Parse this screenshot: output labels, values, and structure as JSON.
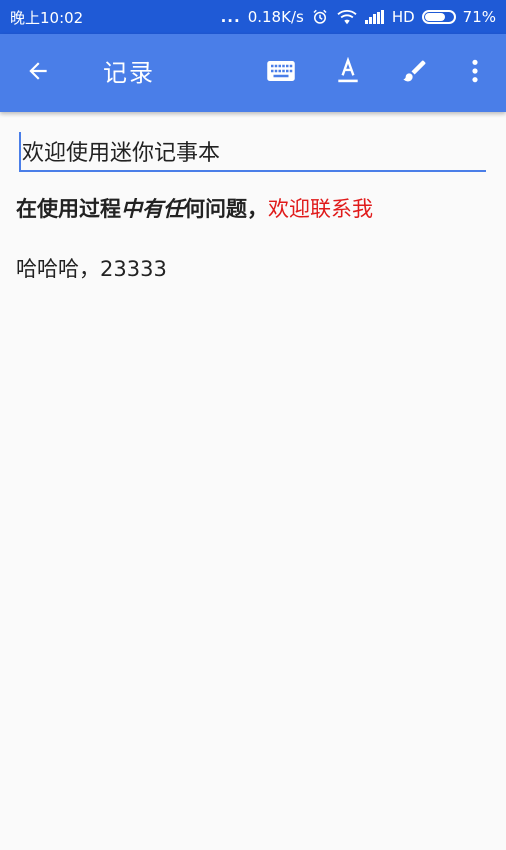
{
  "status_bar": {
    "time": "晚上10:02",
    "dots": "...",
    "speed": "0.18K/s",
    "network": "HD",
    "battery": "71%",
    "battery_level": 71
  },
  "app_bar": {
    "title": "记录",
    "icons": {
      "back": "arrow-back-icon",
      "keyboard": "keyboard-icon",
      "text_format": "text-format-icon",
      "brush": "brush-icon",
      "more": "more-vert-icon"
    }
  },
  "note": {
    "title_value": "欢迎使用迷你记事本",
    "line1": {
      "part1_bold": "在使用过程",
      "part2_bold_italic": "中有任",
      "part3_bold": "何问题，",
      "part4_red": "欢迎联系我"
    },
    "line2": "哈哈哈，23333"
  },
  "colors": {
    "status_bar": "#1f5ad6",
    "app_bar": "#4a7ee8",
    "accent": "#4a7ee8",
    "highlight_text": "#e01b1b"
  }
}
